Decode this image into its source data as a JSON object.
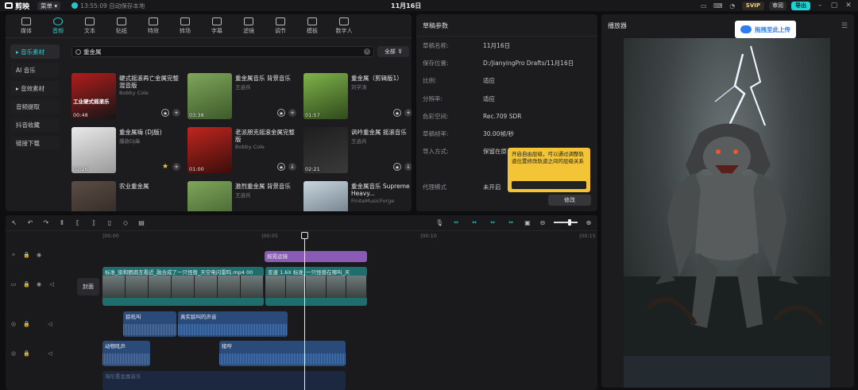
{
  "app": {
    "name": "剪映",
    "menu_label": "菜单",
    "save_status": "13:55:09 自动保存本地",
    "project_title": "11月16日",
    "svip_label": "SVIP",
    "review_label": "审阅",
    "export_label": "导出"
  },
  "media_tabs": [
    {
      "label": "媒体"
    },
    {
      "label": "音频"
    },
    {
      "label": "文本"
    },
    {
      "label": "贴纸"
    },
    {
      "label": "特效"
    },
    {
      "label": "转场"
    },
    {
      "label": "字幕"
    },
    {
      "label": "滤镜"
    },
    {
      "label": "调节"
    },
    {
      "label": "模板"
    },
    {
      "label": "数字人"
    }
  ],
  "side_categories": [
    {
      "label": "▸ 音乐素材"
    },
    {
      "label": "AI 音乐"
    },
    {
      "label": "▸ 音效素材"
    },
    {
      "label": "音频提取"
    },
    {
      "label": "抖音收藏"
    },
    {
      "label": "链接下载"
    }
  ],
  "search": {
    "value": "重金属",
    "filter_label": "全部"
  },
  "tracks": [
    {
      "title": "硬式摇滚再亡金属完整混音版",
      "artist": "Bobby Cole",
      "duration": "00:48",
      "thumb_text": "工业硬式摇滚乐",
      "fav": false,
      "colors": [
        "#b31c1c",
        "#151515"
      ]
    },
    {
      "title": "重金属音乐 背景音乐",
      "artist": "王逍兵",
      "duration": "03:38",
      "thumb_text": "",
      "fav": false,
      "colors": [
        "#7fa65b",
        "#3d5a2a"
      ]
    },
    {
      "title": "重金属（剪辑版1）",
      "artist": "刘学涛",
      "duration": "01:57",
      "thumb_text": "",
      "fav": false,
      "colors": [
        "#7fb34a",
        "#2f4a1c"
      ]
    },
    {
      "title": "重金属嗨 (DJ版)",
      "artist": "爆款DJ串",
      "duration": "02:26",
      "thumb_text": "",
      "fav": true,
      "colors": [
        "#e9e9e9",
        "#9a9a9a"
      ]
    },
    {
      "title": "老派朋克摇滚金属完整版",
      "artist": "Bobby Cole",
      "duration": "01:00",
      "thumb_text": "",
      "fav": false,
      "colors": [
        "#c0261f",
        "#3a0d0a"
      ]
    },
    {
      "title": "讽吟重金属 摇滚音乐",
      "artist": "王逍兵",
      "duration": "02:21",
      "thumb_text": "",
      "fav": false,
      "colors": [
        "#1e1e1e",
        "#3a3a3a"
      ]
    },
    {
      "title": "农业重金属",
      "artist": "",
      "duration": "",
      "thumb_text": "",
      "fav": false,
      "colors": [
        "#5a4d45",
        "#2c2420"
      ]
    },
    {
      "title": "激烈重金属 背景音乐",
      "artist": "王逍兵",
      "duration": "",
      "thumb_text": "",
      "fav": false,
      "colors": [
        "#7fa65b",
        "#3d5a2a"
      ]
    },
    {
      "title": "重金属音乐 Supreme Heavy...",
      "artist": "FiniteMusicForge",
      "duration": "",
      "thumb_text": "",
      "fav": false,
      "colors": [
        "#c9d6de",
        "#5b6b78"
      ]
    }
  ],
  "draft": {
    "header": "草稿参数",
    "rows": [
      {
        "label": "草稿名称:",
        "value": "11月16日"
      },
      {
        "label": "保存位置:",
        "value": "D:/JianyingPro Drafts/11月16日"
      },
      {
        "label": "比例:",
        "value": "适应"
      },
      {
        "label": "分辨率:",
        "value": "适应"
      },
      {
        "label": "色彩空间:",
        "value": "Rec.709 SDR"
      },
      {
        "label": "草稿帧率:",
        "value": "30.00帧/秒"
      },
      {
        "label": "导入方式:",
        "value": "保留在原"
      },
      {
        "label": "",
        "value": ""
      },
      {
        "label": "代理模式",
        "value": "未开启"
      }
    ],
    "tooltip": "开启自由层级，可以通过调整轨道位置修改轨道之间的层级关系",
    "modify_label": "修改"
  },
  "player": {
    "header": "播放器",
    "upload_label": "拖拽至此上传"
  },
  "timeline": {
    "ruler": [
      {
        "label": "|00:00"
      },
      {
        "label": "|00:05"
      },
      {
        "label": "|00:10"
      },
      {
        "label": "|00:15"
      }
    ],
    "cover_label": "封面",
    "effect_clip": "摇晃运镜",
    "video_clip_1": "标准_狼和鹦鹉互看近_融合成了一只怪兽_天空电闪雷鸣.mp4  00",
    "video_clip_2": "变速 1.6X  标准_一只怪兽在哪叫_天",
    "audio_1a": "狼吼叫",
    "audio_1b": "真实狼叫的声音",
    "audio_2a": "动物吼声",
    "audio_2b": "猪哼",
    "audio_3": "海伦重金属音乐"
  }
}
